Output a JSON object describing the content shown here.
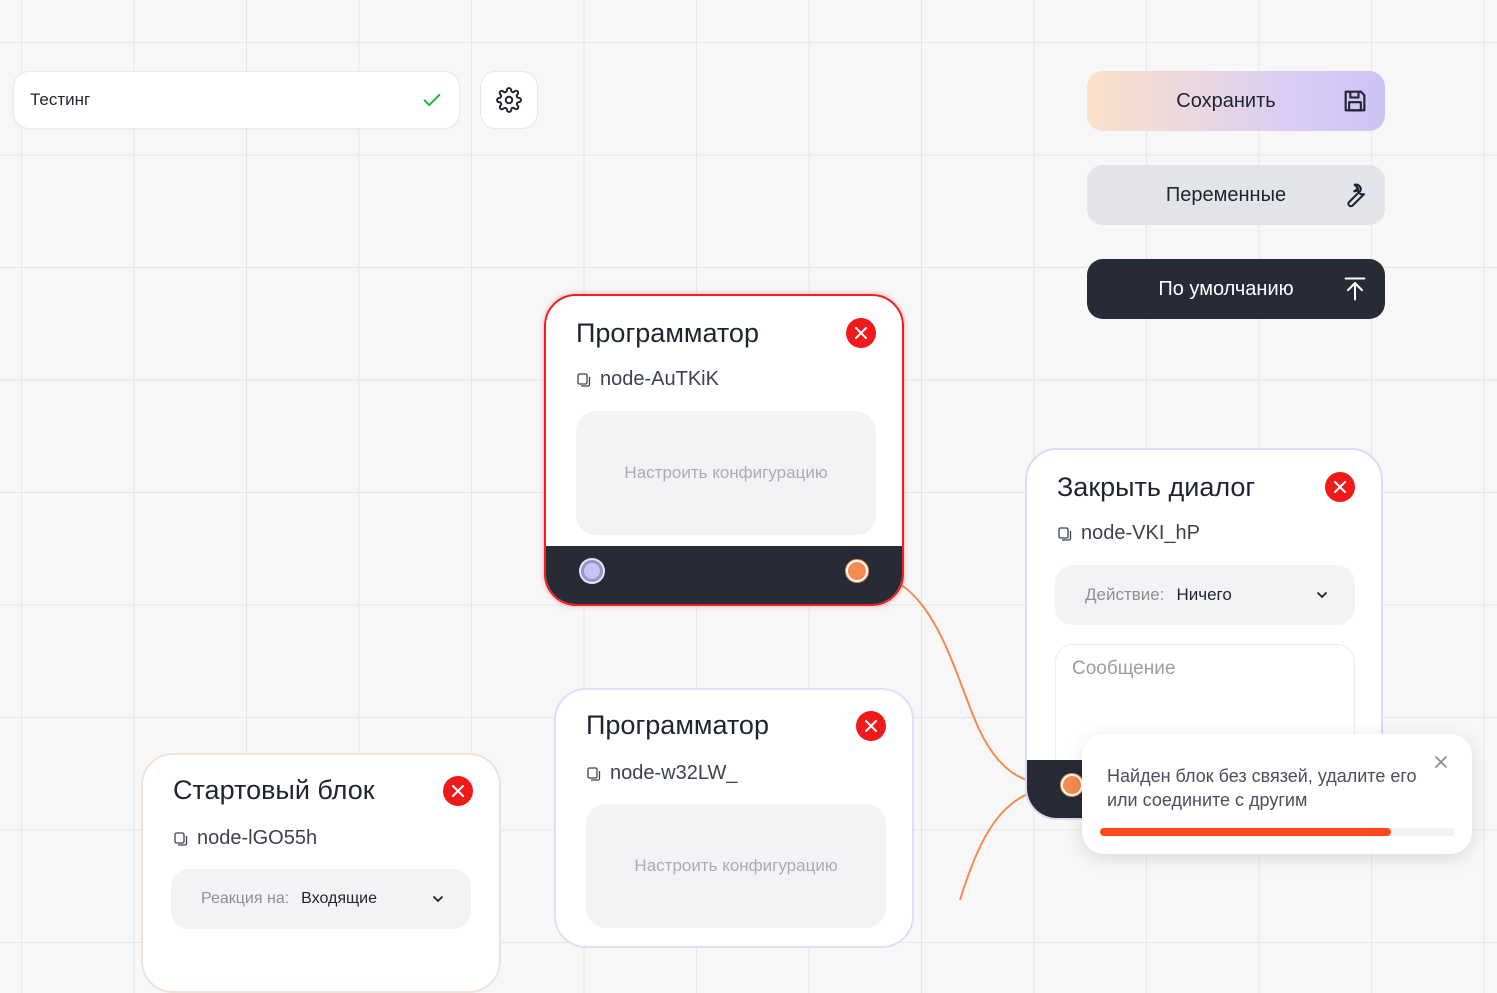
{
  "flow": {
    "name": "Тестинг",
    "name_status_icon": "check-icon",
    "settings_icon": "gear-icon"
  },
  "actions": {
    "save_label": "Сохранить",
    "save_icon": "floppy-disk-icon",
    "variables_label": "Переменные",
    "variables_icon": "wrench-icon",
    "default_label": "По умолчанию",
    "default_icon": "upload-arrow-icon"
  },
  "nodes": [
    {
      "title": "Программатор",
      "id": "node-AuTKiK",
      "config_label": "Настроить конфигурацию",
      "state": "error"
    },
    {
      "title": "Закрыть диалог",
      "id": "node-VKI_hP",
      "action_label": "Действие:",
      "action_value": "Ничего",
      "message_placeholder": "Сообщение"
    },
    {
      "title": "Программатор",
      "id": "node-w32LW_",
      "config_label": "Настроить конфигурацию"
    },
    {
      "title": "Стартовый блок",
      "id": "node-lGO55h",
      "reaction_label": "Реакция на:",
      "reaction_value": "Входящие"
    }
  ],
  "toast": {
    "message": "Найден блок без связей, удалите его или соедините с другим",
    "progress_percent": 82,
    "progress_color": "#fc4a1a"
  },
  "colors": {
    "wire": "#f58b4f",
    "error_border": "#f02020",
    "delete": "#f01a1a",
    "dark": "#262b36"
  }
}
